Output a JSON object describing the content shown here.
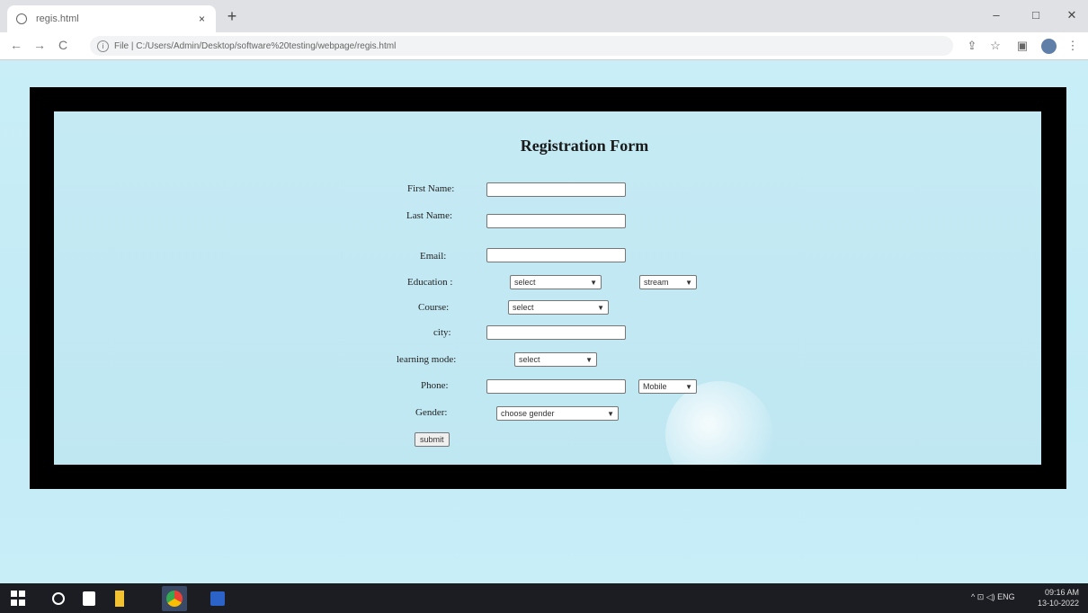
{
  "browser": {
    "tab_title": "regis.html",
    "tab_close": "×",
    "new_tab": "+",
    "url": "File | C:/Users/Admin/Desktop/software%20testing/webpage/regis.html",
    "window_controls": {
      "minimize": "–",
      "maximize": "□",
      "close": "✕"
    },
    "nav": {
      "back": "←",
      "forward": "→",
      "reload": "C"
    }
  },
  "form": {
    "title": "Registration Form",
    "first_name_label": "First Name:",
    "last_name_label": "Last Name:",
    "email_label": "Email:",
    "education_label": "Education :",
    "education_select": "select",
    "education_stream": "stream",
    "course_label": "Course:",
    "course_select": "select",
    "city_label": "city:",
    "learning_mode_label": "learning mode:",
    "learning_mode_select": "select",
    "phone_label": "Phone:",
    "phone_type": "Mobile",
    "gender_label": "Gender:",
    "gender_select": "choose gender",
    "submit_label": "submit"
  },
  "taskbar": {
    "time": "09:16 AM",
    "date": "13-10-2022",
    "tray_text": "^ ⊡ ◁) ENG"
  }
}
